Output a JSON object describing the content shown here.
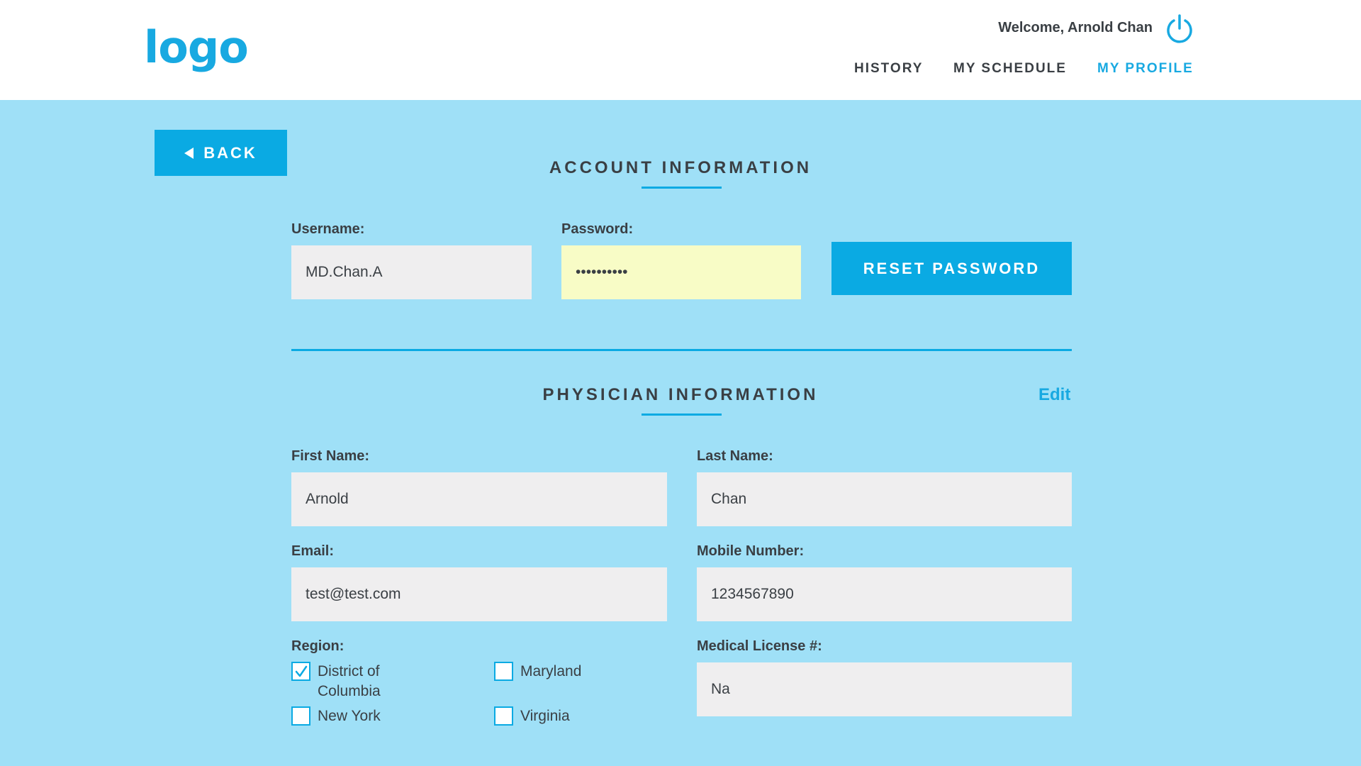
{
  "header": {
    "logo": "logo",
    "welcome": "Welcome, Arnold Chan",
    "nav": [
      {
        "label": "HISTORY",
        "active": false
      },
      {
        "label": "MY SCHEDULE",
        "active": false
      },
      {
        "label": "MY PROFILE",
        "active": true
      }
    ]
  },
  "back_label": "BACK",
  "account": {
    "title": "ACCOUNT INFORMATION",
    "username_label": "Username:",
    "username_value": "MD.Chan.A",
    "password_label": "Password:",
    "password_value": "••••••••••",
    "reset_label": "RESET PASSWORD"
  },
  "physician": {
    "title": "PHYSICIAN INFORMATION",
    "edit_label": "Edit",
    "first_name_label": "First Name:",
    "first_name_value": "Arnold",
    "last_name_label": "Last Name:",
    "last_name_value": "Chan",
    "email_label": "Email:",
    "email_value": "test@test.com",
    "mobile_label": "Mobile Number:",
    "mobile_value": "1234567890",
    "region_label": "Region:",
    "regions": [
      {
        "label": "District of Columbia",
        "line1": "District of",
        "line2": "Columbia",
        "checked": true
      },
      {
        "label": "Maryland",
        "checked": false
      },
      {
        "label": "New York",
        "checked": false
      },
      {
        "label": "Virginia",
        "checked": false
      }
    ],
    "license_label": "Medical License #:",
    "license_value": "Na"
  },
  "colors": {
    "accent": "#0aaae3",
    "background": "#9fe0f7",
    "field": "#efeeef",
    "password_field": "#f8fcc6",
    "text": "#3a3f44"
  },
  "icons": {
    "power": "power-icon",
    "back": "triangle-left-icon",
    "check": "checkmark-icon"
  }
}
